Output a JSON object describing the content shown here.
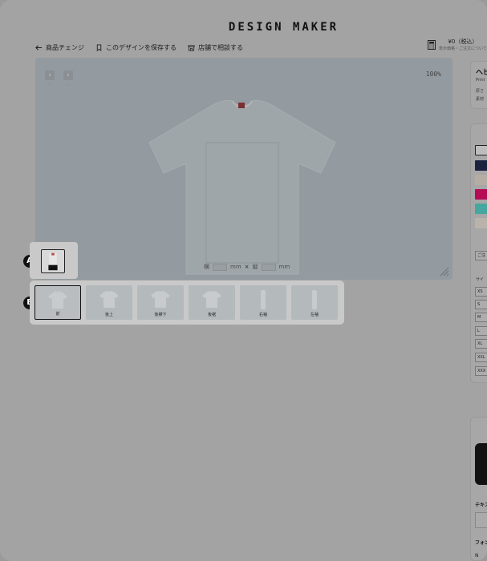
{
  "brand": "DESIGN MAKER",
  "toolbar": {
    "change_product": "商品チェンジ",
    "save_design": "このデザインを保存する",
    "consult_store": "店舗で相談する"
  },
  "price": {
    "amount": "¥0（税込）",
    "note": "表示価格・ご注文について"
  },
  "canvas": {
    "zoom": "100%",
    "dims": {
      "width_label": "横",
      "height_label": "縦",
      "unit": "mm",
      "times": "×"
    }
  },
  "markers": {
    "a": "A",
    "b": "B"
  },
  "views": [
    {
      "label": "前",
      "active": true
    },
    {
      "label": "後上",
      "active": false
    },
    {
      "label": "後襟下",
      "active": false
    },
    {
      "label": "後裾",
      "active": false
    },
    {
      "label": "右袖",
      "active": false
    },
    {
      "label": "左袖",
      "active": false
    }
  ],
  "right_panel": {
    "product_title": "ヘビ",
    "product_sub": "Print",
    "thickness": "厚さ",
    "material": "素材",
    "colors": [
      "#bdbdbd",
      "#1c2140",
      "#b5ada3",
      "#b50c55",
      "#45a79f",
      "#b9b3ab"
    ],
    "note_label": "ご注",
    "size_header": "サイ",
    "sizes": [
      "XS",
      "S",
      "M",
      "L",
      "XL",
      "XXL",
      "XXX"
    ],
    "text_label": "テキス",
    "font_label": "フォン",
    "font_value": "N"
  }
}
